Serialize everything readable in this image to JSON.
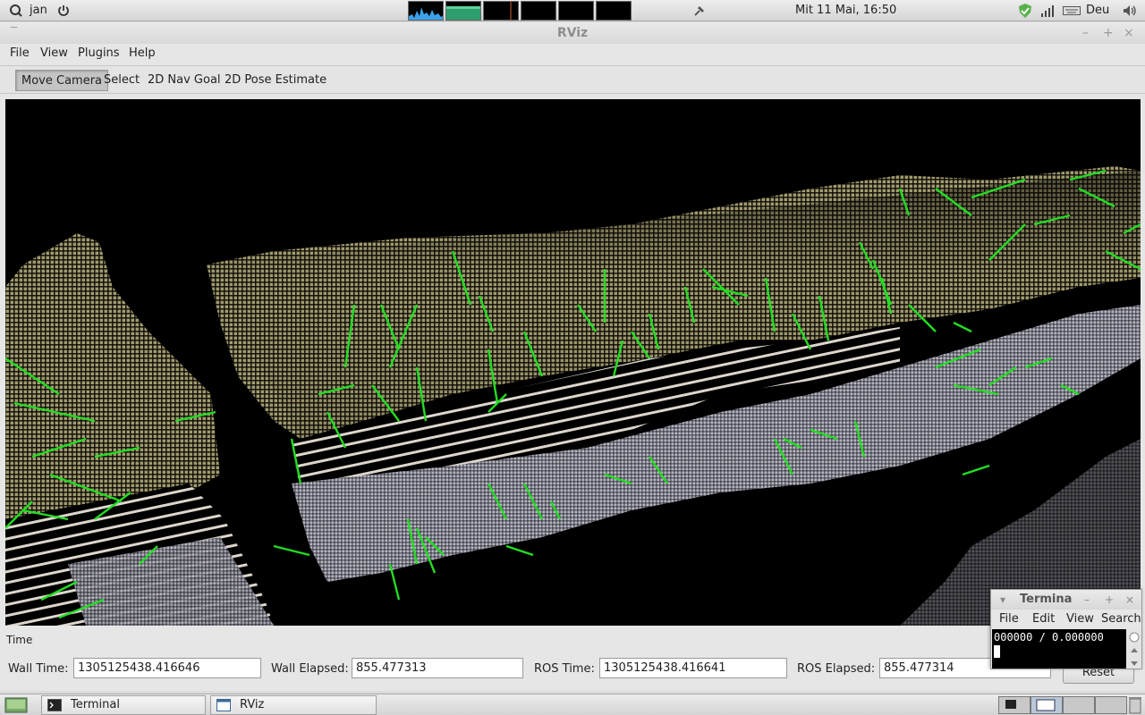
{
  "top_panel": {
    "user": "jan",
    "clock": "Mit 11 Mai, 16:50",
    "keyboard_layout": "Deu"
  },
  "window": {
    "title": "RViz"
  },
  "menu": {
    "file": "File",
    "view": "View",
    "plugins": "Plugins",
    "help": "Help"
  },
  "toolbar": {
    "move_camera": "Move Camera",
    "select": "Select",
    "nav_goal": "2D Nav Goal",
    "pose_estimate": "2D Pose Estimate"
  },
  "time_panel": {
    "title": "Time",
    "wall_time_label": "Wall Time:",
    "wall_time": "1305125438.416646",
    "wall_elapsed_label": "Wall Elapsed:",
    "wall_elapsed": "855.477313",
    "ros_time_label": "ROS Time:",
    "ros_time": "1305125438.416641",
    "ros_elapsed_label": "ROS Elapsed:",
    "ros_elapsed": "855.477314",
    "reset": "Reset"
  },
  "terminal_window": {
    "title": "Termina",
    "menu": [
      "File",
      "Edit",
      "View",
      "Search"
    ],
    "line": "000000 / 0.000000"
  },
  "taskbar": {
    "items": [
      "Terminal",
      "RViz"
    ]
  },
  "colors": {
    "normal_arrows": "#22dd22",
    "point_cloud_upper": "#9c9466",
    "point_cloud_lower": "#b8b8c6"
  }
}
